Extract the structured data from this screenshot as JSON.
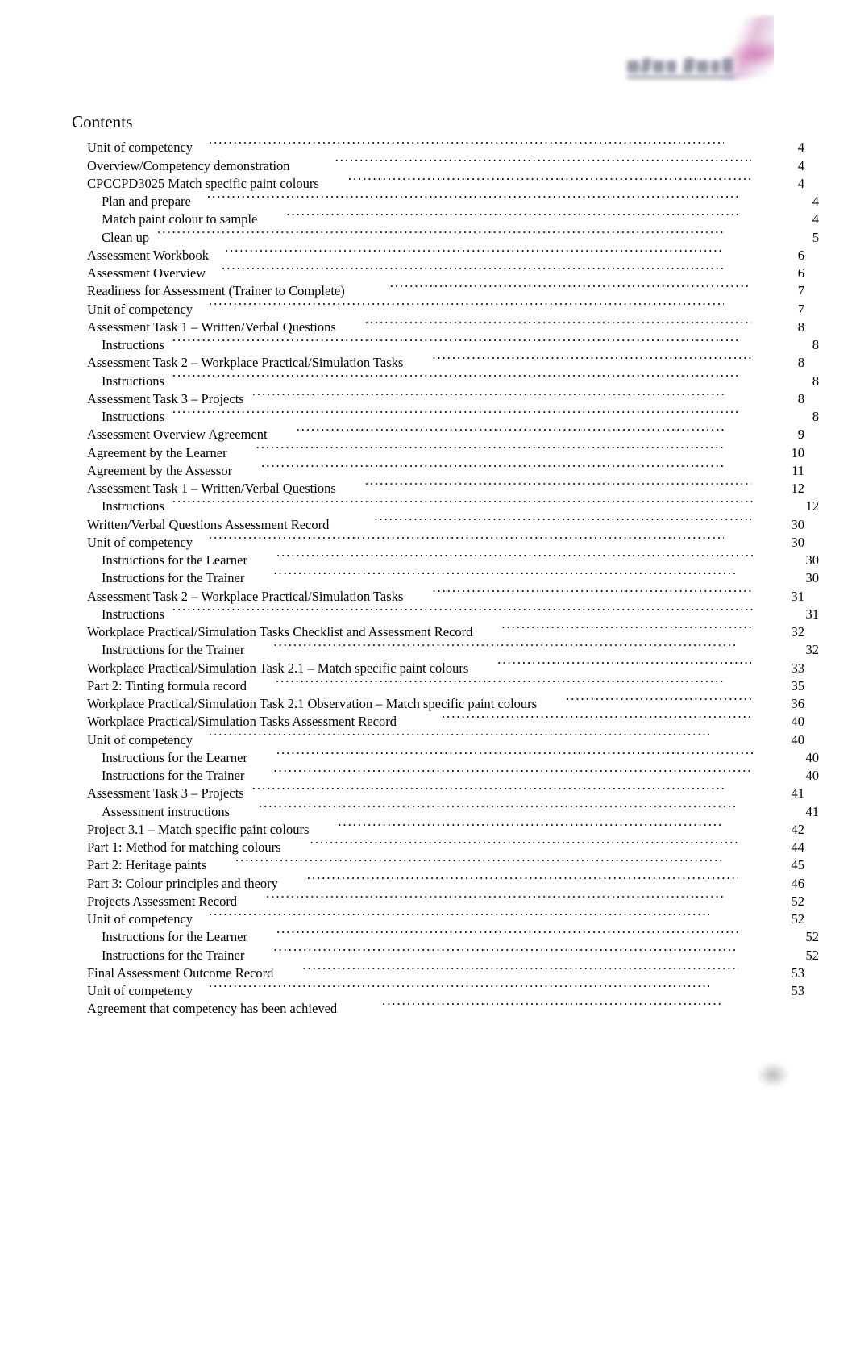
{
  "document": {
    "heading": "Contents"
  },
  "logo": {
    "name": "company-logo",
    "accent_color": "#c44096",
    "wordmark_color": "#6f7289",
    "appearance": "blurred"
  },
  "toc": {
    "entries": [
      {
        "title": "Unit of competency",
        "page": "4",
        "level": 1,
        "gap": "m",
        "lead": "m"
      },
      {
        "title": "Overview/Competency demonstration",
        "page": "4",
        "level": 1,
        "gap": "xl",
        "lead": "xs"
      },
      {
        "title": "CPCCPD3025 Match specific paint colours",
        "page": "4",
        "level": 1,
        "gap": "l",
        "lead": "xs"
      },
      {
        "title": "Plan and prepare",
        "page": "4",
        "level": 2,
        "gap": "m",
        "lead": "m"
      },
      {
        "title": "Match paint colour to sample",
        "page": "4",
        "level": 2,
        "gap": "l",
        "lead": "m"
      },
      {
        "title": "Clean up",
        "page": "5",
        "level": 2,
        "gap": "s",
        "lead": "l"
      },
      {
        "title": "Assessment Workbook",
        "page": "6",
        "level": 1,
        "gap": "m",
        "lead": "m"
      },
      {
        "title": "Assessment Overview",
        "page": "6",
        "level": 1,
        "gap": "m",
        "lead": "m"
      },
      {
        "title": "Readiness for Assessment (Trainer to Complete)",
        "page": "7",
        "level": 1,
        "gap": "xl",
        "lead": "xs"
      },
      {
        "title": "Unit of competency",
        "page": "7",
        "level": 1,
        "gap": "m",
        "lead": "m"
      },
      {
        "title": "Assessment Task 1    – Written/Verbal Questions",
        "page": "8",
        "level": 1,
        "gap": "l",
        "lead": "xs"
      },
      {
        "title": "Instructions",
        "page": "8",
        "level": 2,
        "gap": "s",
        "lead": "m"
      },
      {
        "title": "Assessment Task 2    – Workplace Practical/Simulation Tasks",
        "page": "8",
        "level": 1,
        "gap": "l",
        "lead": "xs"
      },
      {
        "title": "Instructions",
        "page": "8",
        "level": 2,
        "gap": "s",
        "lead": "m"
      },
      {
        "title": "Assessment Task 3    – Projects",
        "page": "8",
        "level": 1,
        "gap": "s",
        "lead": "m"
      },
      {
        "title": "Instructions",
        "page": "8",
        "level": 2,
        "gap": "s",
        "lead": "m"
      },
      {
        "title": "Assessment Overview Agreement",
        "page": "9",
        "level": 1,
        "gap": "l",
        "lead": "m"
      },
      {
        "title": "Agreement by the Learner",
        "page": "10",
        "level": 1,
        "gap": "l",
        "lead": "m"
      },
      {
        "title": "Agreement by the Assessor",
        "page": "11",
        "level": 1,
        "gap": "l",
        "lead": "m"
      },
      {
        "title": "Assessment Task 1    – Written/Verbal Questions",
        "page": "12",
        "level": 1,
        "gap": "l",
        "lead": "xs"
      },
      {
        "title": "Instructions",
        "page": "12",
        "level": 2,
        "gap": "s",
        "lead": "s"
      },
      {
        "title": "Written/Verbal Questions Assessment Record",
        "page": "30",
        "level": 1,
        "gap": "xl",
        "lead": "xs"
      },
      {
        "title": "Unit of competency",
        "page": "30",
        "level": 1,
        "gap": "m",
        "lead": "m"
      },
      {
        "title": "Instructions for the Learner",
        "page": "30",
        "level": 2,
        "gap": "l",
        "lead": "s"
      },
      {
        "title": "Instructions for the Trainer",
        "page": "30",
        "level": 2,
        "gap": "l",
        "lead": "m"
      },
      {
        "title": "Assessment Task 2    – Workplace Practical/Simulation Tasks",
        "page": "31",
        "level": 1,
        "gap": "l",
        "lead": "xs"
      },
      {
        "title": "Instructions",
        "page": "31",
        "level": 2,
        "gap": "s",
        "lead": "s"
      },
      {
        "title": "Workplace Practical/Simulation Tasks Checklist and Assessment Record",
        "page": "32",
        "level": 1,
        "gap": "l",
        "lead": "xs"
      },
      {
        "title": "Instructions for the Trainer",
        "page": "32",
        "level": 2,
        "gap": "l",
        "lead": "m"
      },
      {
        "title": "Workplace Practical/Simulation Task 2.1      – Match specific paint colours",
        "page": "33",
        "level": 1,
        "gap": "l",
        "lead": "xs"
      },
      {
        "title": "Part 2: Tinting formula record",
        "page": "35",
        "level": 1,
        "gap": "l",
        "lead": "m"
      },
      {
        "title": "Workplace Practical/Simulation Task 2.1 Observation       – Match specific paint colours",
        "page": "36",
        "level": 1,
        "gap": "l",
        "lead": "xs"
      },
      {
        "title": "Workplace Practical/Simulation Tasks Assessment Record",
        "page": "40",
        "level": 1,
        "gap": "xl",
        "lead": "xs"
      },
      {
        "title": "Unit of competency",
        "page": "40",
        "level": 1,
        "gap": "m",
        "lead": "l"
      },
      {
        "title": "Instructions for the Learner",
        "page": "40",
        "level": 2,
        "gap": "l",
        "lead": "s"
      },
      {
        "title": "Instructions for the Trainer",
        "page": "40",
        "level": 2,
        "gap": "l",
        "lead": "s"
      },
      {
        "title": "Assessment Task 3    – Projects",
        "page": "41",
        "level": 1,
        "gap": "s",
        "lead": "m"
      },
      {
        "title": "Assessment instructions",
        "page": "41",
        "level": 2,
        "gap": "l",
        "lead": "m"
      },
      {
        "title": "Project 3.1   – Match specific paint colours",
        "page": "42",
        "level": 1,
        "gap": "l",
        "lead": "m"
      },
      {
        "title": "Part 1: Method for matching colours",
        "page": "44",
        "level": 1,
        "gap": "l",
        "lead": "s"
      },
      {
        "title": "Part 2: Heritage paints",
        "page": "45",
        "level": 1,
        "gap": "l",
        "lead": "m"
      },
      {
        "title": "Part 3: Colour principles and theory",
        "page": "46",
        "level": 1,
        "gap": "l",
        "lead": "s"
      },
      {
        "title": "Projects Assessment Record",
        "page": "52",
        "level": 1,
        "gap": "l",
        "lead": "m"
      },
      {
        "title": "Unit of competency",
        "page": "52",
        "level": 1,
        "gap": "m",
        "lead": "l"
      },
      {
        "title": "Instructions for the Learner",
        "page": "52",
        "level": 2,
        "gap": "l",
        "lead": "m"
      },
      {
        "title": "Instructions for the Trainer",
        "page": "52",
        "level": 2,
        "gap": "l",
        "lead": "m"
      },
      {
        "title": "Final Assessment Outcome Record",
        "page": "53",
        "level": 1,
        "gap": "l",
        "lead": "s"
      },
      {
        "title": "Unit of competency",
        "page": "53",
        "level": 1,
        "gap": "m",
        "lead": "l"
      },
      {
        "title": "Agreement that competency has been achieved",
        "page": "",
        "level": 1,
        "gap": "xl",
        "lead": "m"
      }
    ]
  }
}
